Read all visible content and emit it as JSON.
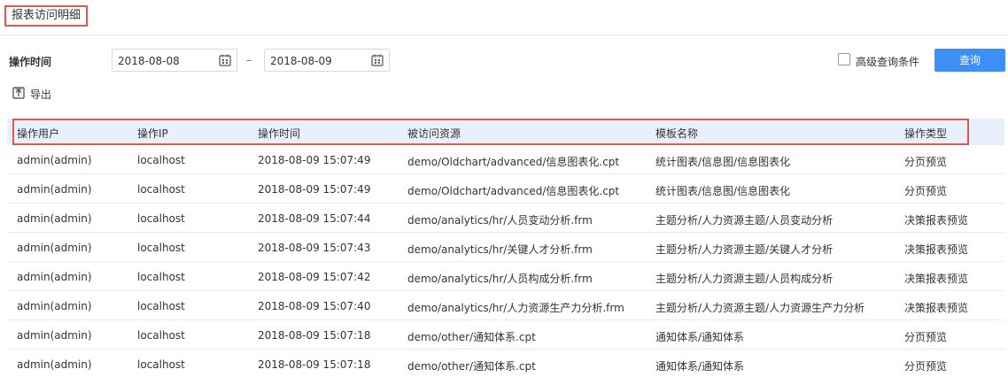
{
  "page": {
    "title": "报表访问明细"
  },
  "filter": {
    "label": "操作时间",
    "start_date": "2018-08-08",
    "separator": "–",
    "end_date": "2018-08-09",
    "advanced_label": "高级查询条件",
    "advanced_checked": false,
    "query_label": "查询",
    "accent": "#3d8ef5"
  },
  "toolbar": {
    "export_label": "导出",
    "export_icon": "export-icon"
  },
  "table": {
    "headers": [
      "操作用户",
      "操作IP",
      "操作时间",
      "被访问资源",
      "模板名称",
      "操作类型"
    ],
    "rows": [
      [
        "admin(admin)",
        "localhost",
        "2018-08-09 15:07:49",
        "demo/Oldchart/advanced/信息图表化.cpt",
        "统计图表/信息图/信息图表化",
        "分页预览"
      ],
      [
        "admin(admin)",
        "localhost",
        "2018-08-09 15:07:49",
        "demo/Oldchart/advanced/信息图表化.cpt",
        "统计图表/信息图/信息图表化",
        "分页预览"
      ],
      [
        "admin(admin)",
        "localhost",
        "2018-08-09 15:07:44",
        "demo/analytics/hr/人员变动分析.frm",
        "主题分析/人力资源主题/人员变动分析",
        "决策报表预览"
      ],
      [
        "admin(admin)",
        "localhost",
        "2018-08-09 15:07:43",
        "demo/analytics/hr/关键人才分析.frm",
        "主题分析/人力资源主题/关键人才分析",
        "决策报表预览"
      ],
      [
        "admin(admin)",
        "localhost",
        "2018-08-09 15:07:42",
        "demo/analytics/hr/人员构成分析.frm",
        "主题分析/人力资源主题/人员构成分析",
        "决策报表预览"
      ],
      [
        "admin(admin)",
        "localhost",
        "2018-08-09 15:07:40",
        "demo/analytics/hr/人力资源生产力分析.frm",
        "主题分析/人力资源主题/人力资源生产力分析",
        "决策报表预览"
      ],
      [
        "admin(admin)",
        "localhost",
        "2018-08-09 15:07:18",
        "demo/other/通知体系.cpt",
        "通知体系/通知体系",
        "分页预览"
      ],
      [
        "admin(admin)",
        "localhost",
        "2018-08-09 15:07:18",
        "demo/other/通知体系.cpt",
        "通知体系/通知体系",
        "分页预览"
      ]
    ]
  }
}
